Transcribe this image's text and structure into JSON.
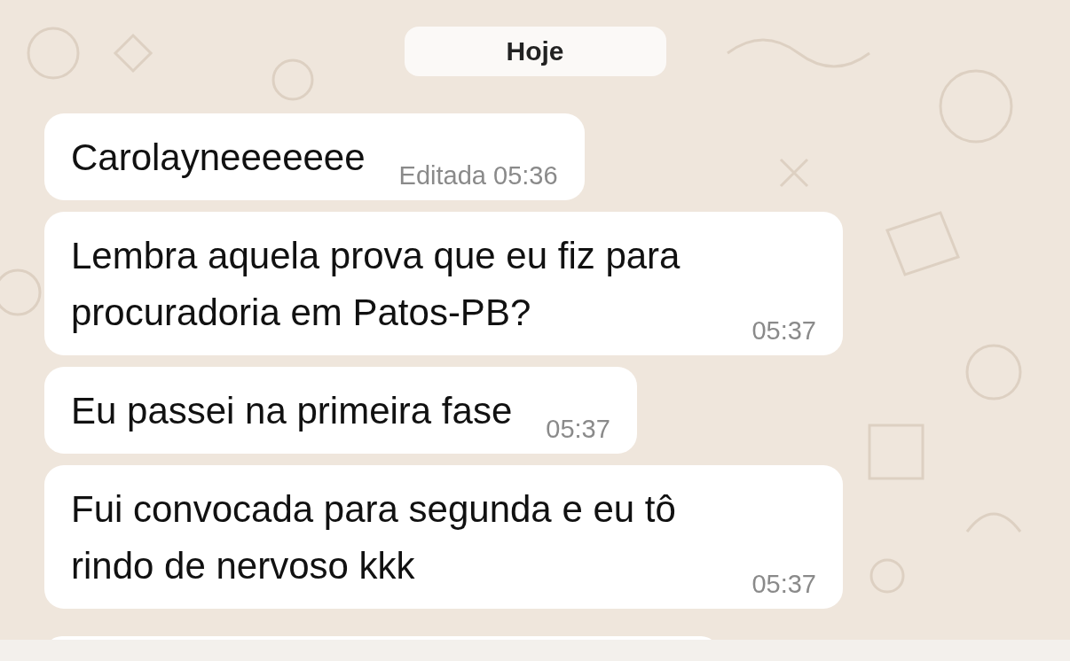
{
  "date_divider": "Hoje",
  "messages": [
    {
      "text": "Carolayneeeeeee",
      "edited_label": "Editada",
      "time": "05:36"
    },
    {
      "text": "Lembra aquela prova que eu fiz para procuradoria em Patos-PB?",
      "time": "05:37"
    },
    {
      "text": "Eu passei na primeira fase",
      "time": "05:37"
    },
    {
      "text": "Fui convocada para segunda e eu tô rindo de nervoso kkk",
      "time": "05:37"
    }
  ]
}
